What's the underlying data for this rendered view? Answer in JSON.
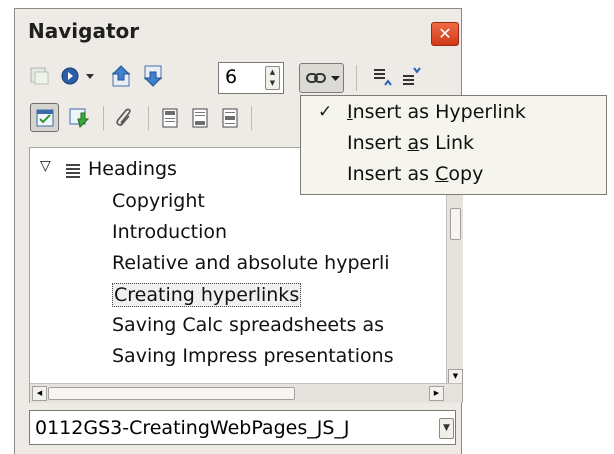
{
  "window": {
    "title": "Navigator",
    "close_glyph": "✕"
  },
  "toolbar": {
    "page_number": "6",
    "icons": [
      "toggle-icon",
      "navigation-icon",
      "dropdown-icon",
      "previous-icon",
      "next-icon",
      "drag-mode-icon",
      "heading-levels-icon",
      "promote-chapter-icon",
      "demote-chapter-icon",
      "content-view-icon",
      "set-reminder-icon",
      "header-icon",
      "footer-icon",
      "anchor-icon",
      "promote-level-icon",
      "demote-level-icon"
    ]
  },
  "drag_mode_menu": {
    "items": [
      {
        "check": "✓",
        "pre": "",
        "accel": "I",
        "post": "nsert as Hyperlink"
      },
      {
        "check": "",
        "pre": "Insert ",
        "accel": "a",
        "post": "s Link"
      },
      {
        "check": "",
        "pre": "Insert as ",
        "accel": "C",
        "post": "opy"
      }
    ]
  },
  "tree": {
    "root": {
      "expander": "▽",
      "label": "Headings"
    },
    "items": [
      "Copyright",
      "Introduction",
      "Relative and absolute hyperli",
      "Creating hyperlinks",
      "Saving Calc spreadsheets as",
      "Saving Impress presentations"
    ],
    "selected_index": 3
  },
  "document_select": {
    "value": "0112GS3-CreatingWebPages_JS_J"
  },
  "colors": {
    "panel": "#eeebe6",
    "close": "#e04a27",
    "menu": "#f5f4ed"
  }
}
